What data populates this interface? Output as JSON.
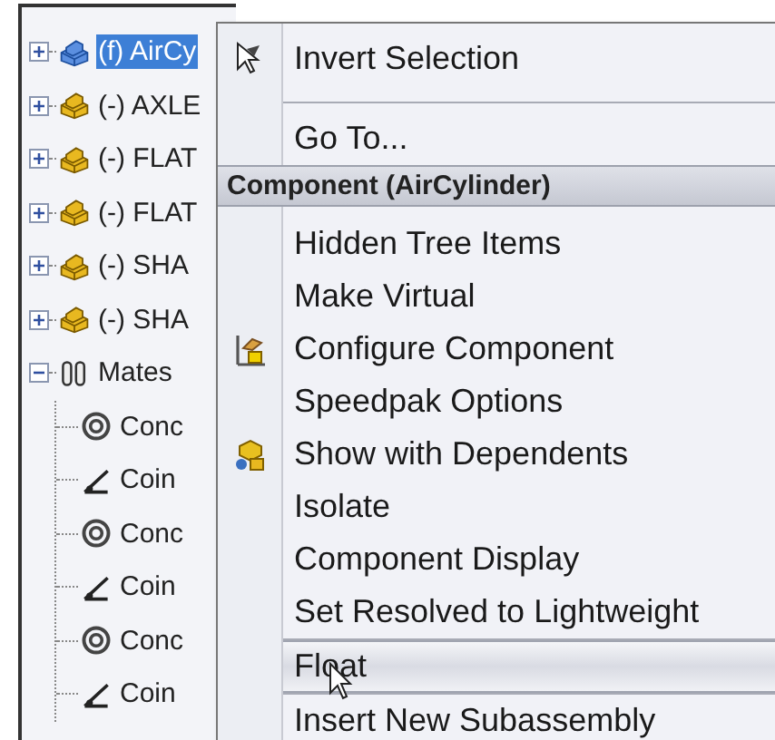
{
  "tree": {
    "items": [
      {
        "label": "(f) AirCy",
        "selected": true
      },
      {
        "label": "(-) AXLE",
        "selected": false
      },
      {
        "label": "(-) FLAT",
        "selected": false
      },
      {
        "label": "(-) FLAT",
        "selected": false
      },
      {
        "label": "(-) SHA",
        "selected": false
      },
      {
        "label": "(-) SHA",
        "selected": false
      }
    ],
    "mates": {
      "label": "Mates",
      "expanded": true,
      "children": [
        {
          "kind": "concentric",
          "label": "Conc"
        },
        {
          "kind": "coincident",
          "label": "Coin"
        },
        {
          "kind": "concentric",
          "label": "Conc"
        },
        {
          "kind": "coincident",
          "label": "Coin"
        },
        {
          "kind": "concentric",
          "label": "Conc"
        },
        {
          "kind": "coincident",
          "label": "Coin"
        }
      ]
    }
  },
  "context_menu": {
    "items": [
      {
        "kind": "pointer",
        "label": "Invert Selection",
        "selected": false
      },
      {
        "kind": "separator"
      },
      {
        "kind": "item",
        "label": "Go To...",
        "selected": false
      },
      {
        "kind": "header",
        "label": "Component (AirCylinder)"
      },
      {
        "kind": "item",
        "label": "Hidden Tree Items",
        "selected": false
      },
      {
        "kind": "item",
        "label": "Make Virtual",
        "selected": false
      },
      {
        "kind": "configure",
        "label": "Configure Component",
        "selected": false
      },
      {
        "kind": "item",
        "label": "Speedpak Options",
        "selected": false
      },
      {
        "kind": "dependents",
        "label": "Show with Dependents",
        "selected": false
      },
      {
        "kind": "item",
        "label": "Isolate",
        "selected": false
      },
      {
        "kind": "item",
        "label": "Component Display",
        "selected": false
      },
      {
        "kind": "item",
        "label": "Set Resolved to Lightweight",
        "selected": false
      },
      {
        "kind": "separator"
      },
      {
        "kind": "item",
        "label": "Float",
        "selected": true
      },
      {
        "kind": "separator"
      },
      {
        "kind": "item",
        "label": "Insert New Subassembly",
        "selected": false
      }
    ]
  }
}
